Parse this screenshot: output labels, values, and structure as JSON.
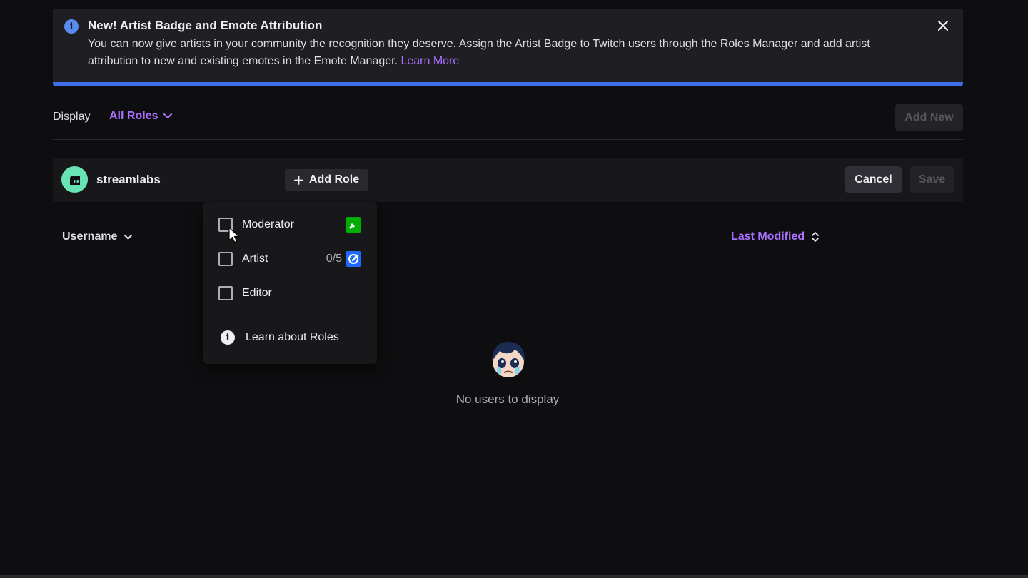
{
  "banner": {
    "title": "New! Artist Badge and Emote Attribution",
    "body": "You can now give artists in your community the recognition they deserve. Assign the Artist Badge to Twitch users through the Roles Manager and add artist attribution to new and existing emotes in the Emote Manager.",
    "link": "Learn More",
    "accent_color": "#3d6fe6"
  },
  "toolbar": {
    "display_label": "Display",
    "filter_value": "All Roles",
    "add_new_label": "Add New"
  },
  "user_card": {
    "username": "streamlabs",
    "add_role_label": "Add Role",
    "cancel_label": "Cancel",
    "save_label": "Save"
  },
  "role_menu": {
    "options": [
      {
        "label": "Moderator",
        "count": "",
        "badge": "sword-icon",
        "checked": false
      },
      {
        "label": "Artist",
        "count": "0/5",
        "badge": "paintbrush-icon",
        "checked": false
      },
      {
        "label": "Editor",
        "count": "",
        "badge": "",
        "checked": false
      }
    ],
    "learn_label": "Learn about Roles"
  },
  "table": {
    "sort_username": "Username",
    "sort_modified": "Last Modified"
  },
  "empty_state": {
    "text": "No users to display"
  }
}
